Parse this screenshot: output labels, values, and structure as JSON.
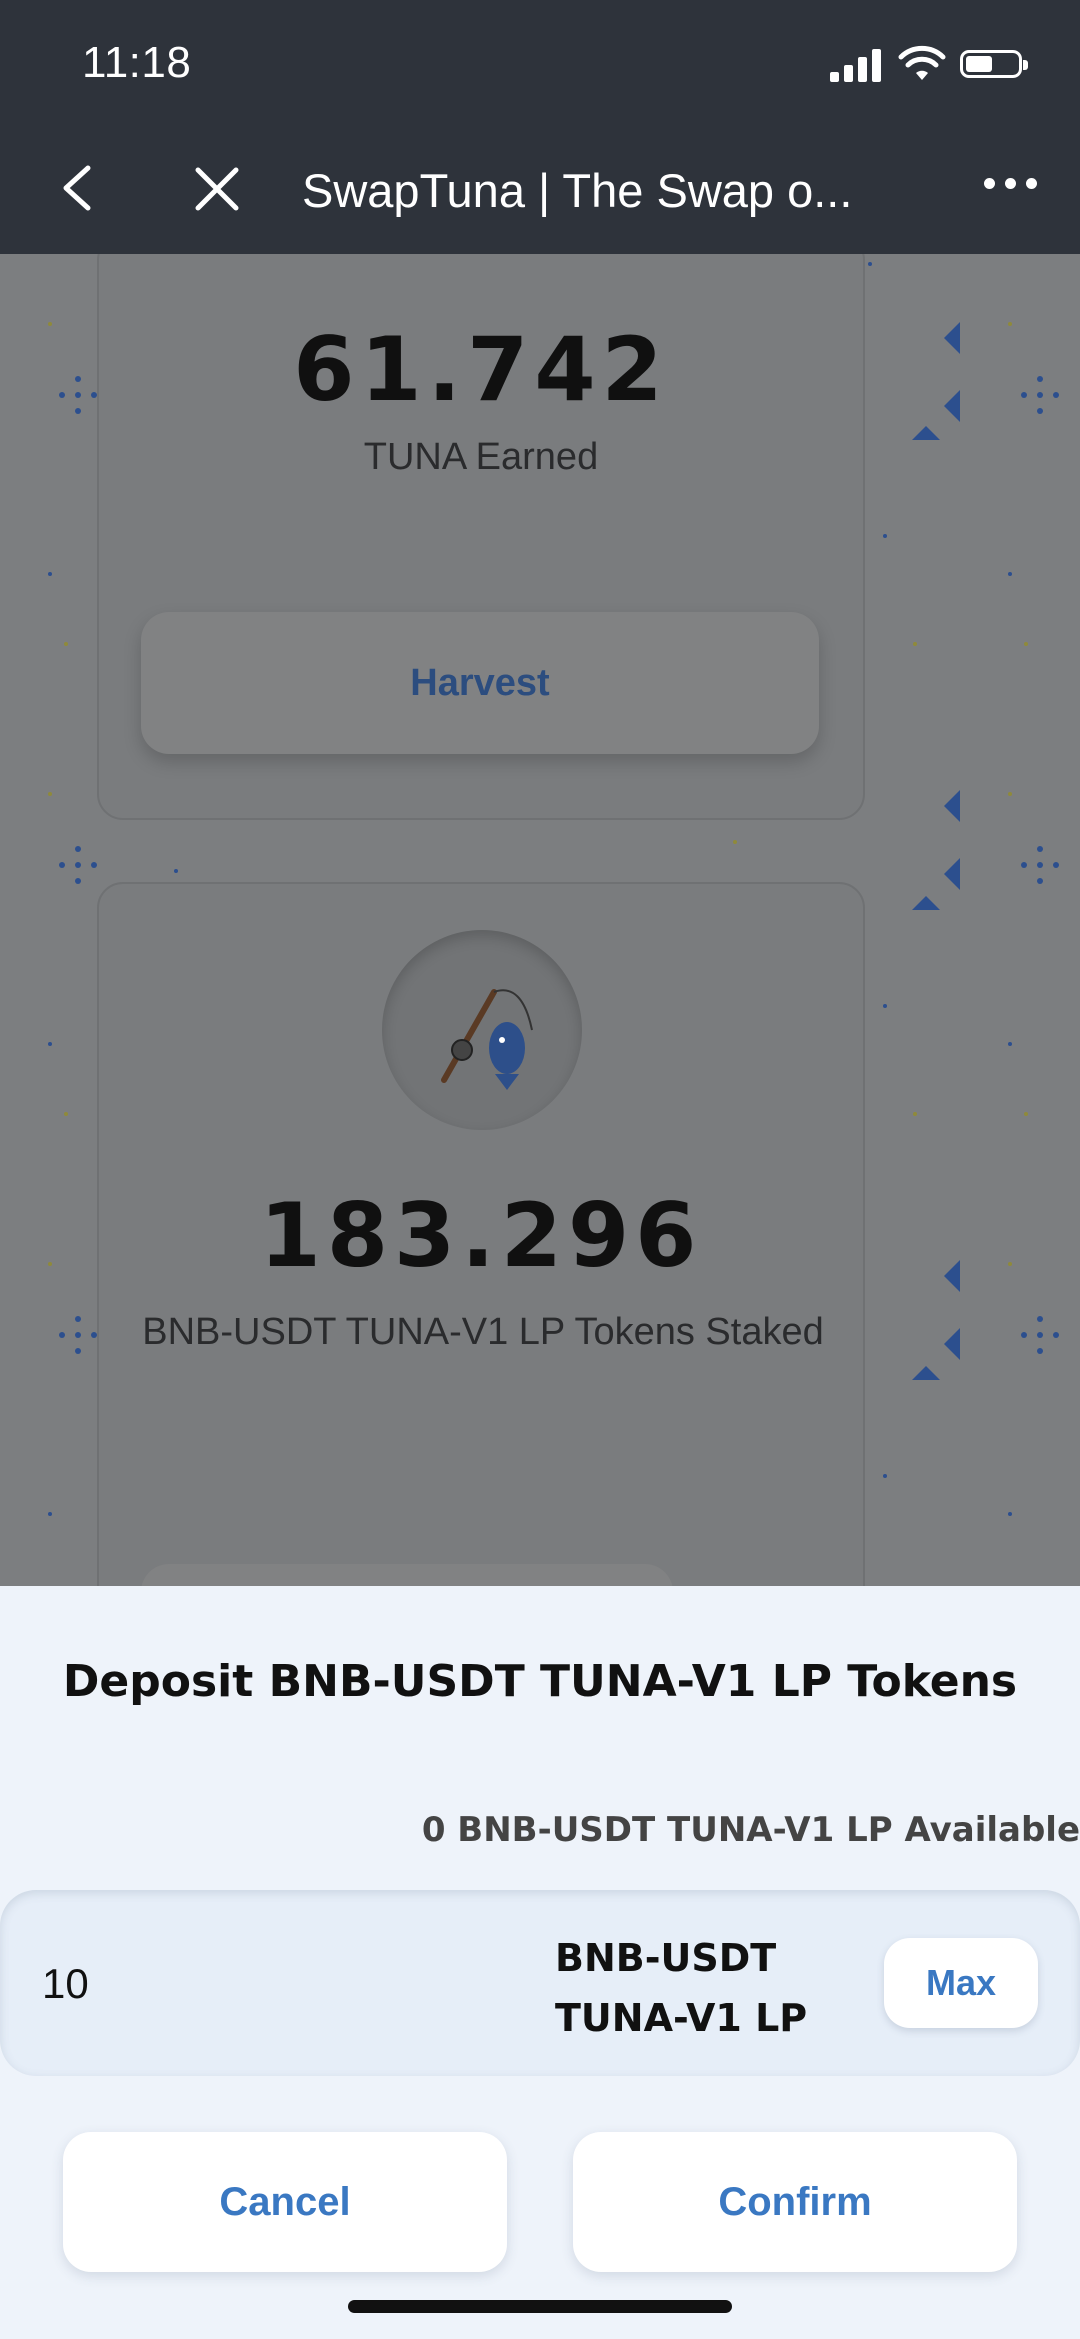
{
  "status_bar": {
    "time": "11:18"
  },
  "nav": {
    "title": "SwapTuna | The Swap o..."
  },
  "farm_card": {
    "earned_value": "61.742",
    "earned_label": "TUNA Earned",
    "harvest_label": "Harvest"
  },
  "stake_card": {
    "staked_value": "183.296",
    "staked_label": "BNB-USDT TUNA-V1 LP Tokens Staked",
    "icon": "fishing-rod-fish-icon"
  },
  "deposit_sheet": {
    "title": "Deposit BNB-USDT TUNA-V1 LP Tokens",
    "available": "0 BNB-USDT TUNA-V1 LP Available",
    "amount_value": "10",
    "token_line1": "BNB-USDT",
    "token_line2": "TUNA-V1 LP",
    "max_label": "Max",
    "cancel_label": "Cancel",
    "confirm_label": "Confirm"
  },
  "colors": {
    "accent": "#3a78c2",
    "nav_bg": "#2e333b",
    "sheet_bg": "#eef3fa"
  }
}
